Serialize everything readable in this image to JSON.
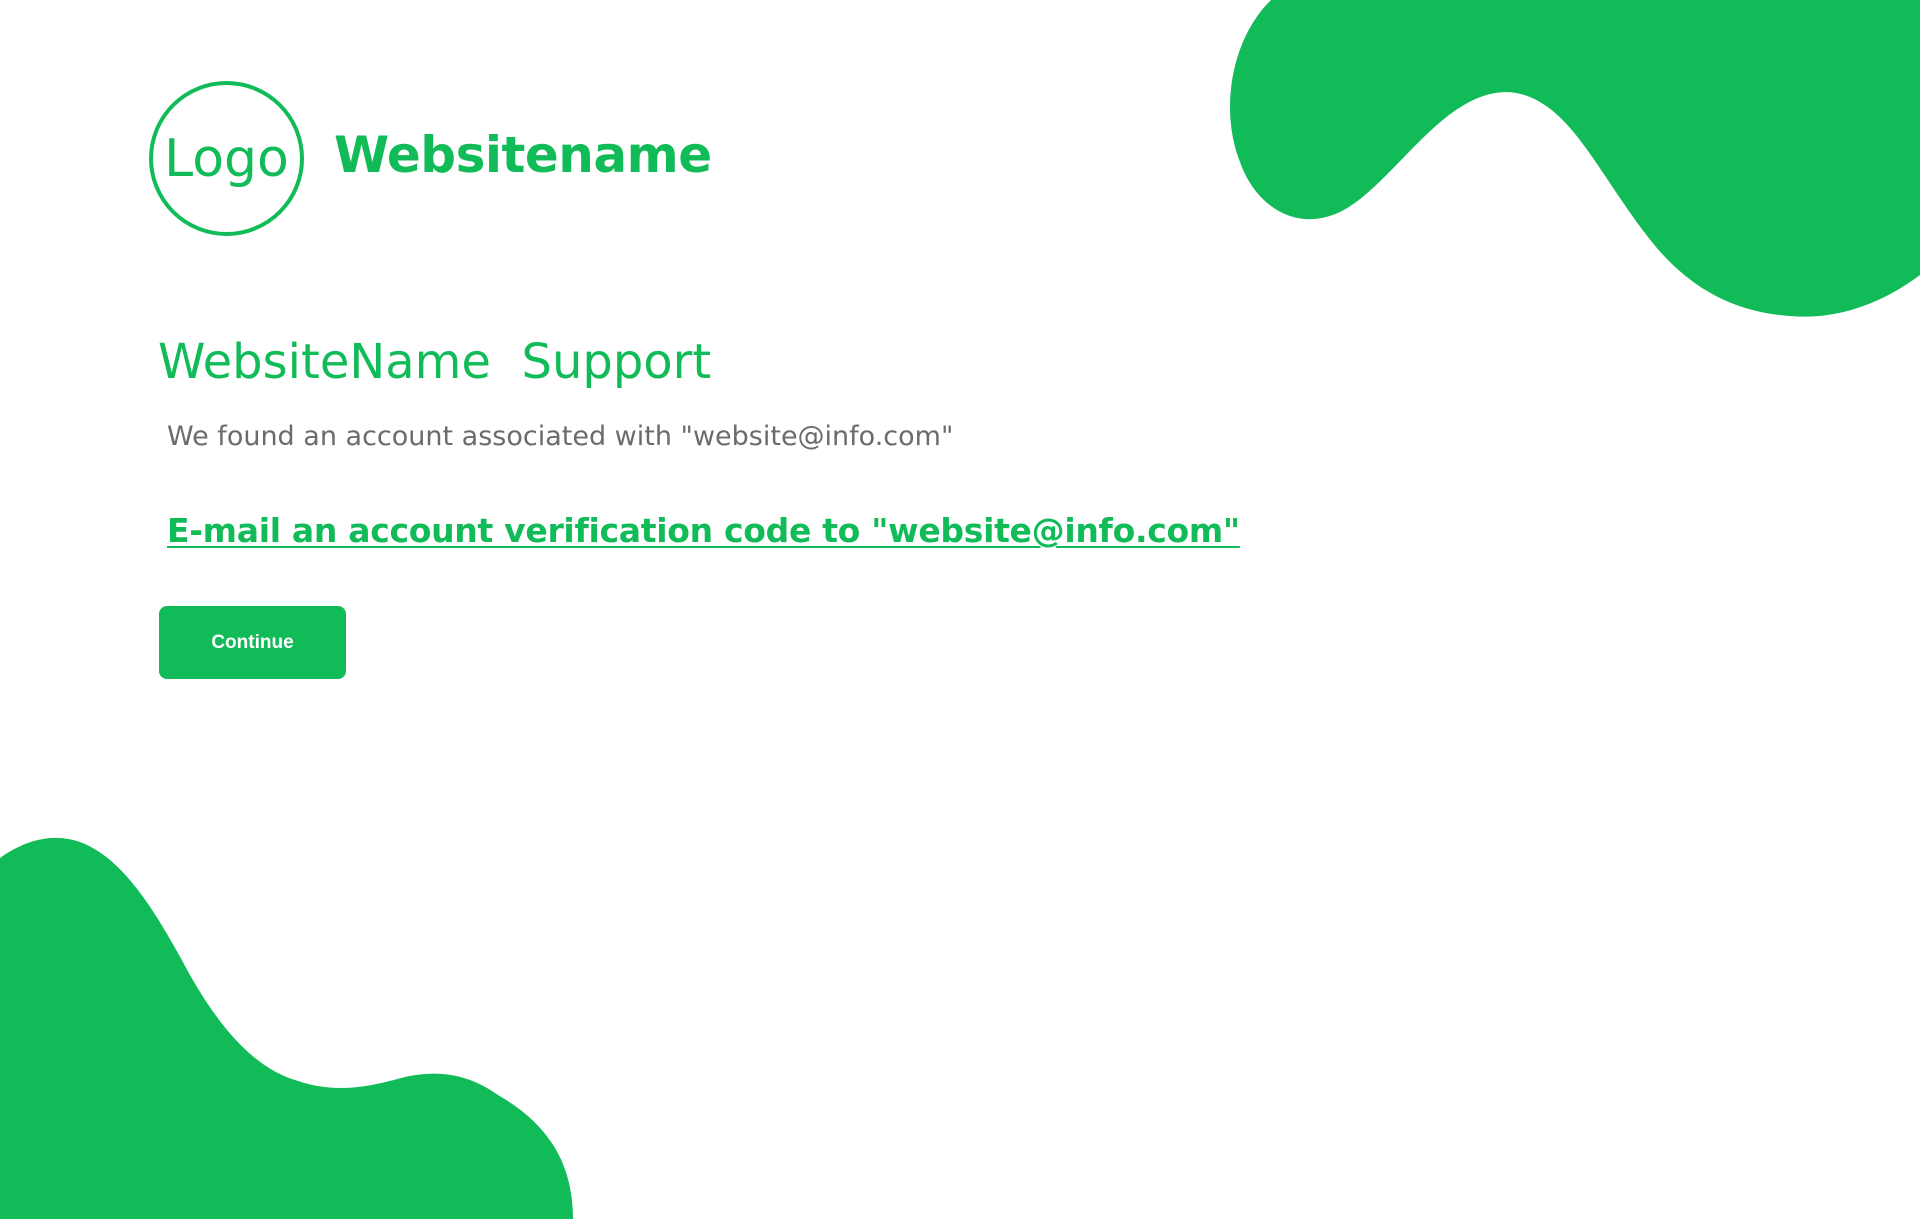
{
  "brand": {
    "logo_text": "Logo",
    "site_name": "Websitename",
    "accent_color": "#10bb58"
  },
  "content": {
    "title": "WebsiteName  Support",
    "account_message": "We found an account associated with \"website@info.com\"",
    "verification_link": "E-mail an account verification code to \"website@info.com\"",
    "continue_label": "Continue"
  },
  "colors": {
    "background": "#ffffff",
    "text_muted": "#6b6b6b",
    "button_text": "#ffffff"
  }
}
